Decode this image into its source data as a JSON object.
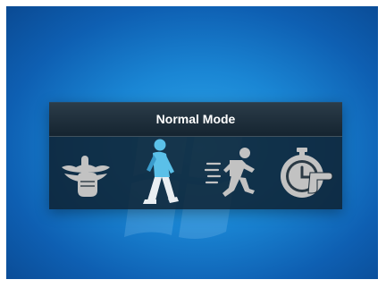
{
  "osd": {
    "title": "Normal Mode",
    "modes": [
      {
        "id": "silent",
        "icon": "silent-mode-icon",
        "active": false
      },
      {
        "id": "normal",
        "icon": "walking-person-icon",
        "active": true
      },
      {
        "id": "turbo",
        "icon": "running-person-icon",
        "active": false
      },
      {
        "id": "auto",
        "icon": "stopwatch-icon",
        "active": false
      }
    ]
  },
  "colors": {
    "active_icon": "#5bc0e8",
    "inactive_icon": "#c2c2c2",
    "panel_bg": "#0e2232"
  }
}
